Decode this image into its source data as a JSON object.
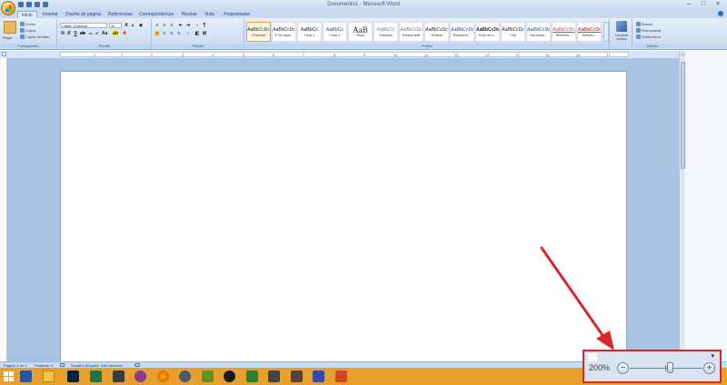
{
  "window": {
    "title": "Documento1 - Microsoft Word"
  },
  "tabs": [
    "Inicio",
    "Insertar",
    "Diseño de página",
    "Referencias",
    "Correspondencia",
    "Revisar",
    "Vista",
    "Programador"
  ],
  "ribbon": {
    "clipboard": {
      "paste": "Pegar",
      "cut": "Cortar",
      "copy": "Copiar",
      "format_painter": "Copiar formato",
      "label": "Portapapeles"
    },
    "font": {
      "name": "Calibri (Cuerpo)",
      "size": "11",
      "label": "Fuente"
    },
    "paragraph": {
      "label": "Párrafo"
    },
    "styles": {
      "items": [
        {
          "preview": "AaBbCcDc",
          "name": "¶ Normal"
        },
        {
          "preview": "AaBbCcDc",
          "name": "¶ Sin espa..."
        },
        {
          "preview": "AaBbCc",
          "name": "Título 1"
        },
        {
          "preview": "AaBbCc",
          "name": "Título 2"
        },
        {
          "preview": "AaB",
          "name": "Título"
        },
        {
          "preview": "AaBbCcI",
          "name": "Subtítulo"
        },
        {
          "preview": "AaBbCcDc",
          "name": "Énfasis sutil"
        },
        {
          "preview": "AaBbCcDc",
          "name": "Énfasis"
        },
        {
          "preview": "AaBbCcDc",
          "name": "Énfasis int..."
        },
        {
          "preview": "AaBbCcDc",
          "name": "Texto en n..."
        },
        {
          "preview": "AaBbCcDc",
          "name": "Cita"
        },
        {
          "preview": "AaBbCcDc",
          "name": "Cita desta..."
        },
        {
          "preview": "AaBbCcDc",
          "name": "Referenc..."
        },
        {
          "preview": "AaBbCcDc",
          "name": "Referen..."
        }
      ],
      "change_styles": "Cambiar estilos",
      "label": "Estilos"
    },
    "editing": {
      "find": "Buscar",
      "replace": "Reemplazar",
      "select": "Seleccionar",
      "label": "Edición"
    }
  },
  "ruler": {
    "numbers": [
      "1",
      "1",
      "2",
      "3",
      "4",
      "5",
      "6",
      "7",
      "8",
      "9",
      "10",
      "11",
      "12",
      "13",
      "14",
      "15",
      "16",
      "17"
    ]
  },
  "statusbar": {
    "page": "Página: 1 de 1",
    "words": "Palabras: 0",
    "language": "Español (España, internacional)"
  },
  "zoom": {
    "value": "200%",
    "minus": "−",
    "plus": "+",
    "level_fraction": 0.55
  },
  "colors": {
    "taskbar": "#e8a02c",
    "annotation": "#d8262b",
    "ribbon": "#cfdff3"
  },
  "taskbar_icons": [
    "start-icon",
    "word-icon",
    "folder-icon",
    "photoshop-icon",
    "excel-icon",
    "app-icon",
    "app-icon",
    "firefox-icon",
    "app-icon",
    "app-icon",
    "app-icon",
    "app-icon",
    "app-icon",
    "app-icon",
    "app-icon",
    "app-icon",
    "app-icon",
    "app-icon",
    "powerpoint-icon"
  ]
}
